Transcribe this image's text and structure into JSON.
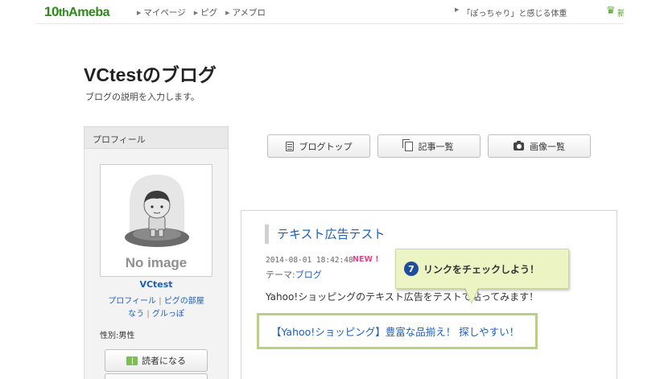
{
  "topbar": {
    "logo_ten": "10",
    "logo_th": "th",
    "logo_ameba": "Ameba",
    "nav": [
      {
        "label": "マイページ"
      },
      {
        "label": "ピグ"
      },
      {
        "label": "アメブロ"
      }
    ],
    "news": "「ぽっちゃり」と感じる体重",
    "crown_text": "新"
  },
  "header": {
    "title": "VCtestのブログ",
    "description": "ブログの説明を入力します。"
  },
  "sidebar": {
    "heading": "プロフィール",
    "no_image": "No image",
    "nickname": "VCtest",
    "link_profile": "プロフィール",
    "link_room": "ピグの部屋",
    "link_now": "なう",
    "link_group": "グルっぽ",
    "gender": "性別:男性",
    "reader_button": "読者になる"
  },
  "nav_buttons": {
    "blog_top": "ブログトップ",
    "entries": "記事一覧",
    "images": "画像一覧"
  },
  "article": {
    "title": "テキスト広告テスト",
    "date": "2014-08-01 18:42:48",
    "new_badge": "NEW !",
    "theme_label": "テーマ:",
    "theme_value": "ブログ",
    "body": "Yahoo!ショッピングのテキスト広告をテストで貼ってみます！",
    "ad_link": "【Yahoo!ショッピング】豊富な品揃え！ 探しやすい！"
  },
  "callout": {
    "number": "7",
    "text": "リンクをチェックしよう！"
  },
  "colors": {
    "link": "#1a5ec0",
    "brand": "#2d8a1a",
    "highlight_border": "#b8d27a",
    "callout_bg": "#edf4c4"
  }
}
